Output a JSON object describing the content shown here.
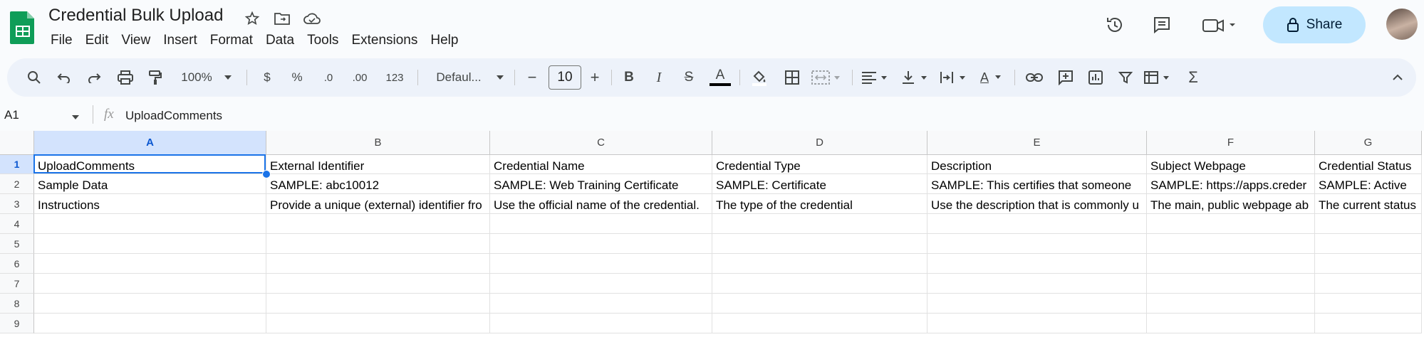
{
  "app": {
    "doc_title": "Credential Bulk Upload",
    "menus": [
      "File",
      "Edit",
      "View",
      "Insert",
      "Format",
      "Data",
      "Tools",
      "Extensions",
      "Help"
    ],
    "share_label": "Share"
  },
  "toolbar": {
    "zoom": "100%",
    "currency": "$",
    "percent": "%",
    "decrease_decimal": ".0",
    "increase_decimal": ".00",
    "number_format": "123",
    "font_name": "Defaul...",
    "font_size": "10",
    "minus": "−",
    "plus": "+",
    "bold": "B",
    "italic": "I",
    "strike": "S",
    "text_color": "A",
    "rotation": "A",
    "functions": "Σ"
  },
  "formula_bar": {
    "cell_ref": "A1",
    "fx": "fx",
    "value": "UploadComments"
  },
  "sheet": {
    "columns": [
      "A",
      "B",
      "C",
      "D",
      "E",
      "F",
      "G"
    ],
    "rows": [
      "1",
      "2",
      "3",
      "4",
      "5",
      "6",
      "7",
      "8",
      "9"
    ],
    "cells": [
      [
        "UploadComments",
        "External Identifier",
        "Credential Name",
        "Credential Type",
        "Description",
        "Subject Webpage",
        "Credential Status"
      ],
      [
        "Sample Data",
        "SAMPLE: abc10012",
        "SAMPLE: Web Training Certificate",
        "SAMPLE: Certificate",
        "SAMPLE: This certifies that someone",
        "SAMPLE: https://apps.creder",
        "SAMPLE: Active"
      ],
      [
        "Instructions",
        "Provide a unique (external) identifier fro",
        "Use the official name of the credential.",
        "The type of the credential",
        "Use the description that is commonly u",
        "The main, public webpage ab",
        "The current status"
      ]
    ]
  }
}
